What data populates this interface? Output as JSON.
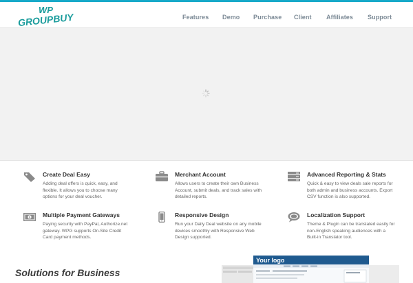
{
  "logo": {
    "line1": "WP",
    "line2": "GROUPBUY"
  },
  "nav": {
    "items": [
      "Features",
      "Demo",
      "Purchase",
      "Client",
      "Affiliates",
      "Support"
    ]
  },
  "features": [
    {
      "title": "Create Deal Easy",
      "description": "Adding deal offers is quick, easy, and flexible. It allows you to choose many options for your deal voucher.",
      "icon": "tag-icon"
    },
    {
      "title": "Merchant Account",
      "description": "Allows users to create their own Business Account, submit deals, and track sales with detailed reports.",
      "icon": "briefcase-icon"
    },
    {
      "title": "Advanced Reporting & Stats",
      "description": "Quick & easy to view deals sale reports for both admin and business accounts. Export CSV function is also supported.",
      "icon": "server-icon"
    },
    {
      "title": "Multiple Payment Gateways",
      "description": "Paying security with PayPal, Authorize.net gateway. WPG supports On-Site Credit Card payment methods.",
      "icon": "money-icon"
    },
    {
      "title": "Responsive Design",
      "description": "Run your Daily Deal website on any mobile devices smoothly with Responsive Web Design supported.",
      "icon": "mobile-icon"
    },
    {
      "title": "Localization Support",
      "description": "Theme & Plugin can be translated easily for non-English speaking audiences with a Built-in Translator tool.",
      "icon": "chat-icon"
    }
  ],
  "solutions": {
    "heading": "Solutions for Business"
  },
  "mockup": {
    "logo_text": "Your logo"
  },
  "colors": {
    "accent": "#17a9c9",
    "logo": "#1a9c9c",
    "nav_text": "#7c8a96",
    "hero_bg": "#f2f2f2"
  }
}
